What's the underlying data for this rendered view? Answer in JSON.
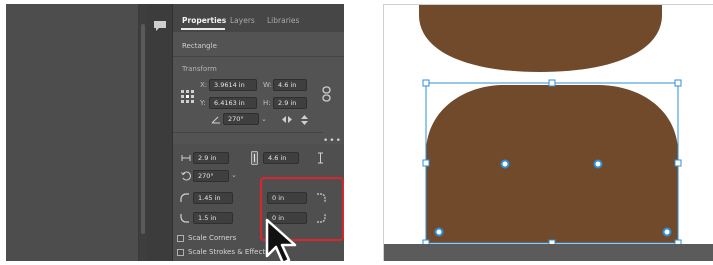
{
  "properties_panel": {
    "tabs": [
      {
        "label": "Properties",
        "active": true
      },
      {
        "label": "Layers",
        "active": false
      },
      {
        "label": "Libraries",
        "active": false
      }
    ],
    "object_type": "Rectangle",
    "transform": {
      "section_label": "Transform",
      "x_label": "X:",
      "x_value": "3.9614 in",
      "y_label": "Y:",
      "y_value": "6.4163 in",
      "w_label": "W:",
      "w_value": "4.6 in",
      "h_label": "H:",
      "h_value": "2.9 in",
      "angle_value": "270°"
    },
    "more_options": "•••"
  },
  "rectangle_properties": {
    "width_value": "2.9 in",
    "height_value": "4.6 in",
    "rotation_value": "270°",
    "corner_top_left": "1.45 in",
    "corner_bottom_left": "1.5 in",
    "corner_top_right": "0 in",
    "corner_bottom_right": "0 in",
    "scale_corners_label": "Scale Corners",
    "scale_strokes_label": "Scale Strokes & Effects",
    "scale_corners_checked": false,
    "scale_strokes_checked": false
  },
  "artboard": {
    "shape_fill": "#714a2b",
    "selection_color": "#2f8fd6"
  },
  "callout": {
    "highlight_color": "#d8262f"
  },
  "icons": {
    "comment": "speech-bubble-icon",
    "reference_point": "reference-point-grid-icon",
    "link": "chain-link-icon",
    "cursor": "arrow-pointer-icon"
  }
}
